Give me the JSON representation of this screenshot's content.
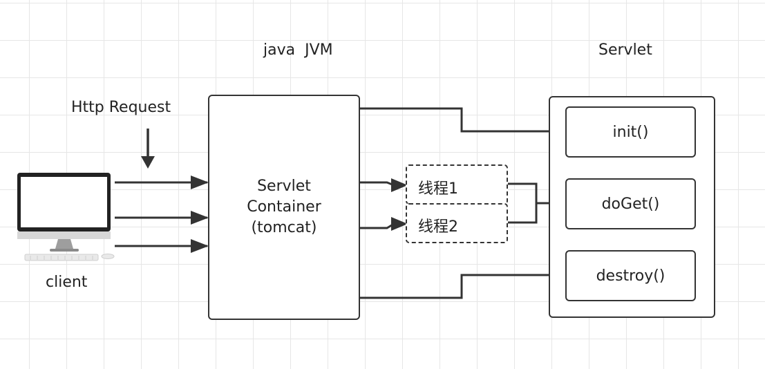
{
  "labels": {
    "jvm": "java  JVM",
    "servlet_title": "Servlet",
    "http_request": "Http Request",
    "client": "client"
  },
  "container": {
    "line1": "Servlet",
    "line2": "Container",
    "line3": "(tomcat)"
  },
  "threads": [
    "线程1",
    "线程2"
  ],
  "methods": [
    "init()",
    "doGet()",
    "destroy()"
  ],
  "colors": {
    "stroke": "#333333",
    "grid": "#e6e6e6",
    "monitor": "#222222",
    "screen": "#ffffff",
    "stand": "#9e9e9e"
  },
  "icons": [
    "desktop-computer-icon",
    "arrow-down-icon"
  ]
}
